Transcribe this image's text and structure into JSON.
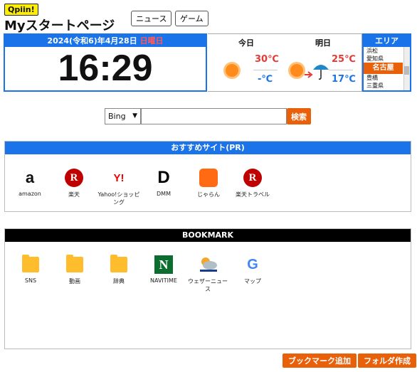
{
  "header": {
    "logo": "Qpiin!",
    "title": "Myスタートページ",
    "news_button": "ニュース",
    "game_button": "ゲーム"
  },
  "clock": {
    "date": "2024(令和6)年4月28日",
    "weekday": "日曜日",
    "time": "16:29"
  },
  "weather": {
    "today": {
      "label": "今日",
      "high": "30℃",
      "low": "-℃",
      "icon": "sun-icon"
    },
    "tomorrow": {
      "label": "明日",
      "high": "25℃",
      "low": "17℃",
      "icon": "sun-then-umbrella-icon"
    }
  },
  "area": {
    "label": "エリア",
    "items": [
      "浜松",
      "愛知県",
      "名古屋",
      "豊橋",
      "三重県"
    ],
    "selected_index": 2
  },
  "search": {
    "engine": "Bing",
    "query": "",
    "button": "検索"
  },
  "recommended": {
    "title": "おすすめサイト(PR)",
    "sites": [
      {
        "label": "amazon",
        "icon": "amazon-icon"
      },
      {
        "label": "楽天",
        "icon": "rakuten-icon"
      },
      {
        "label": "Yahoo!ショッピング",
        "icon": "yahoo-icon"
      },
      {
        "label": "DMM",
        "icon": "dmm-icon"
      },
      {
        "label": "じゃらん",
        "icon": "jalan-icon"
      },
      {
        "label": "楽天トラベル",
        "icon": "rakuten-travel-icon"
      }
    ],
    "logos": {
      "amazon": "a",
      "rakuten": "R",
      "yahoo": "Y!",
      "dmm": "D"
    }
  },
  "bookmark": {
    "title": "BOOKMARK",
    "items": [
      {
        "label": "SNS",
        "icon": "folder-icon"
      },
      {
        "label": "動画",
        "icon": "folder-icon"
      },
      {
        "label": "辞典",
        "icon": "folder-icon"
      },
      {
        "label": "NAVITIME",
        "icon": "navitime-icon"
      },
      {
        "label": "ウェザーニュース",
        "icon": "weathernews-icon"
      },
      {
        "label": "マップ",
        "icon": "google-maps-icon"
      }
    ],
    "logos": {
      "navitime": "N",
      "google": "G"
    }
  },
  "footer": {
    "add_bookmark": "ブックマーク追加",
    "create_folder": "フォルダ作成"
  },
  "colors": {
    "accent_blue": "#1a73e8",
    "accent_orange": "#e8600a",
    "high_temp": "#e53935",
    "low_temp": "#1a73e8"
  }
}
